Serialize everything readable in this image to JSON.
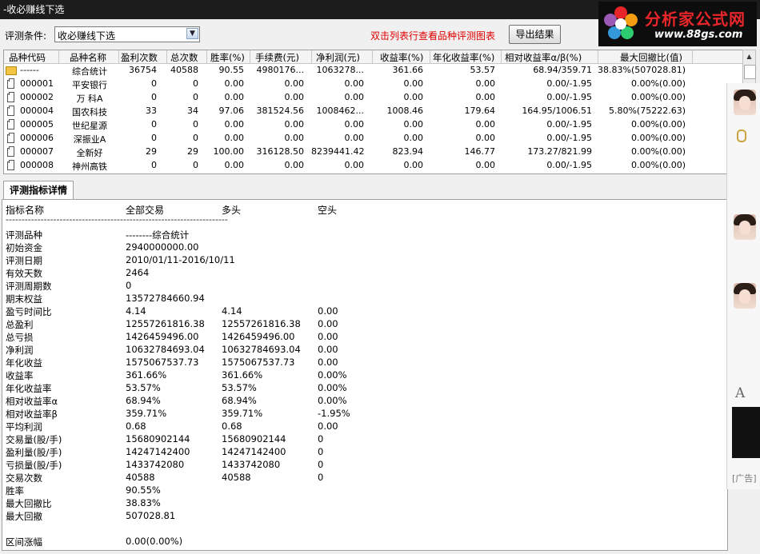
{
  "window": {
    "title": "-收必赚线下选"
  },
  "brand": {
    "name": "分析家公式网",
    "url": "www.88gs.com"
  },
  "toolbar": {
    "condition_label": "评测条件:",
    "condition_value": "收必赚线下选",
    "hint": "双击列表行查看品种评测图表",
    "export_label": "导出结果"
  },
  "table": {
    "headers": [
      "品种代码",
      "品种名称",
      "盈利次数",
      "总次数",
      "胜率(%)",
      "手续费(元)",
      "净利润(元)",
      "收益率(%)",
      "年化收益率(%)",
      "相对收益率α/β(%)",
      "最大回撤比(值)"
    ],
    "rows": [
      {
        "code": "------",
        "name": "综合统计",
        "wins": "36754",
        "total": "40588",
        "winrate": "90.55",
        "fee": "4980176...",
        "profit": "1063278...",
        "ret": "361.66",
        "annual": "53.57",
        "rel": "68.94/359.71",
        "dd": "38.83%(507028.81)"
      },
      {
        "code": "000001",
        "name": "平安银行",
        "wins": "0",
        "total": "0",
        "winrate": "0.00",
        "fee": "0.00",
        "profit": "0.00",
        "ret": "0.00",
        "annual": "0.00",
        "rel": "0.00/-1.95",
        "dd": "0.00%(0.00)"
      },
      {
        "code": "000002",
        "name": "万 科A",
        "wins": "0",
        "total": "0",
        "winrate": "0.00",
        "fee": "0.00",
        "profit": "0.00",
        "ret": "0.00",
        "annual": "0.00",
        "rel": "0.00/-1.95",
        "dd": "0.00%(0.00)"
      },
      {
        "code": "000004",
        "name": "国农科技",
        "wins": "33",
        "total": "34",
        "winrate": "97.06",
        "fee": "381524.56",
        "profit": "1008462...",
        "ret": "1008.46",
        "annual": "179.64",
        "rel": "164.95/1006.51",
        "dd": "5.80%(75222.63)"
      },
      {
        "code": "000005",
        "name": "世纪星源",
        "wins": "0",
        "total": "0",
        "winrate": "0.00",
        "fee": "0.00",
        "profit": "0.00",
        "ret": "0.00",
        "annual": "0.00",
        "rel": "0.00/-1.95",
        "dd": "0.00%(0.00)"
      },
      {
        "code": "000006",
        "name": "深振业A",
        "wins": "0",
        "total": "0",
        "winrate": "0.00",
        "fee": "0.00",
        "profit": "0.00",
        "ret": "0.00",
        "annual": "0.00",
        "rel": "0.00/-1.95",
        "dd": "0.00%(0.00)"
      },
      {
        "code": "000007",
        "name": "全新好",
        "wins": "29",
        "total": "29",
        "winrate": "100.00",
        "fee": "316128.50",
        "profit": "8239441.42",
        "ret": "823.94",
        "annual": "146.77",
        "rel": "173.27/821.99",
        "dd": "0.00%(0.00)"
      },
      {
        "code": "000008",
        "name": "神州高铁",
        "wins": "0",
        "total": "0",
        "winrate": "0.00",
        "fee": "0.00",
        "profit": "0.00",
        "ret": "0.00",
        "annual": "0.00",
        "rel": "0.00/-1.95",
        "dd": "0.00%(0.00)"
      }
    ]
  },
  "detail": {
    "tab_label": "评测指标详情",
    "headers": [
      "指标名称",
      "全部交易",
      "多头",
      "空头"
    ],
    "separator": "----------------------------------------------------------------------",
    "rows": [
      [
        "评测品种",
        "--------综合统计",
        "",
        ""
      ],
      [
        "初始资金",
        "2940000000.00",
        "",
        ""
      ],
      [
        "评测日期",
        "2010/01/11-2016/10/11",
        "",
        ""
      ],
      [
        "有效天数",
        "2464",
        "",
        ""
      ],
      [
        "评测周期数",
        "0",
        "",
        ""
      ],
      [
        "期末权益",
        "13572784660.94",
        "",
        ""
      ],
      [
        "盈亏时间比",
        "4.14",
        "4.14",
        "0.00"
      ],
      [
        "总盈利",
        "12557261816.38",
        "12557261816.38",
        "0.00"
      ],
      [
        "总亏损",
        "1426459496.00",
        "1426459496.00",
        "0.00"
      ],
      [
        "净利润",
        "10632784693.04",
        "10632784693.04",
        "0.00"
      ],
      [
        "年化收益",
        "1575067537.73",
        "1575067537.73",
        "0.00"
      ],
      [
        "收益率",
        "361.66%",
        "361.66%",
        "0.00%"
      ],
      [
        "年化收益率",
        "53.57%",
        "53.57%",
        "0.00%"
      ],
      [
        "相对收益率α",
        "68.94%",
        "68.94%",
        "0.00%"
      ],
      [
        "相对收益率β",
        "359.71%",
        "359.71%",
        "-1.95%"
      ],
      [
        "平均利润",
        "0.68",
        "0.68",
        "0.00"
      ],
      [
        "交易量(股/手)",
        "15680902144",
        "15680902144",
        "0"
      ],
      [
        "盈利量(股/手)",
        "14247142400",
        "14247142400",
        "0"
      ],
      [
        "亏损量(股/手)",
        "1433742080",
        "1433742080",
        "0"
      ],
      [
        "交易次数",
        "40588",
        "40588",
        "0"
      ],
      [
        "胜率",
        "90.55%",
        "",
        ""
      ],
      [
        "最大回撤比",
        "38.83%",
        "",
        ""
      ],
      [
        "最大回撤",
        "507028.81",
        "",
        ""
      ],
      [
        "",
        "",
        " ",
        ""
      ],
      [
        "区间涨幅",
        "0.00(0.00%)",
        "",
        ""
      ]
    ]
  },
  "side": {
    "font_glyph": "A",
    "ad_label": "[广告]"
  }
}
